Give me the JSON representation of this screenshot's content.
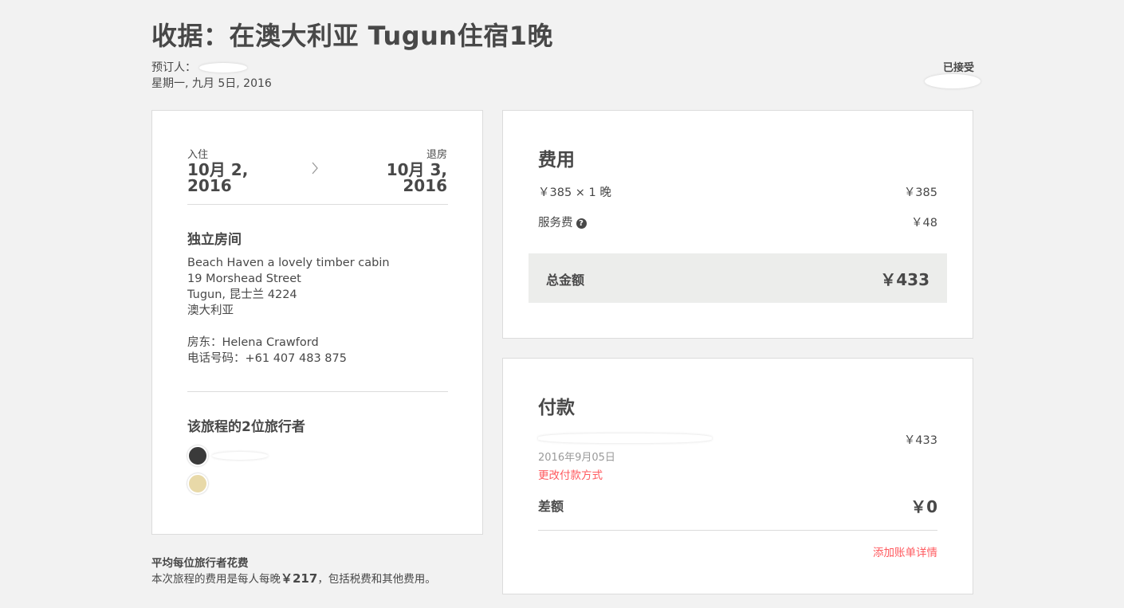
{
  "page": {
    "title": "收据：在澳大利亚 Tugun住宿1晚",
    "booker_label": "预订人：",
    "date": "星期一, 九月 5日, 2016",
    "status": "已接受"
  },
  "trip": {
    "checkin_label": "入住",
    "checkin_date_line1": "10月 2,",
    "checkin_date_line2": "2016",
    "checkout_label": "退房",
    "checkout_date_line1": "10月 3,",
    "checkout_date_line2": "2016",
    "room_type": "独立房间",
    "address": [
      "Beach Haven a lovely timber cabin",
      "19 Morshead Street",
      "Tugun, 昆士兰 4224",
      "澳大利亚"
    ],
    "host": "房东：Helena Crawford",
    "phone": "电话号码：+61 407 483 875",
    "travelers_heading": "该旅程的2位旅行者"
  },
  "footer_note": {
    "heading": "平均每位旅行者花费",
    "text_prefix": "本次旅程的费用是每人每晚",
    "amount": "￥217",
    "text_suffix": "，包括税费和其他费用。"
  },
  "fees": {
    "heading": "费用",
    "nightly_label": "￥385 × 1 晚",
    "nightly_value": "￥385",
    "service_label": "服务费",
    "service_value": "￥48",
    "total_label": "总金额",
    "total_value": "￥433"
  },
  "payment": {
    "heading": "付款",
    "amount": "￥433",
    "paid_date": "2016年9月05日",
    "change_method_link": "更改付款方式",
    "balance_label": "差额",
    "balance_value": "￥0",
    "add_billing_link": "添加账单详情"
  },
  "colors": {
    "link": "#ff5a5f",
    "total_bg": "#ecedeb",
    "text": "#484848"
  }
}
